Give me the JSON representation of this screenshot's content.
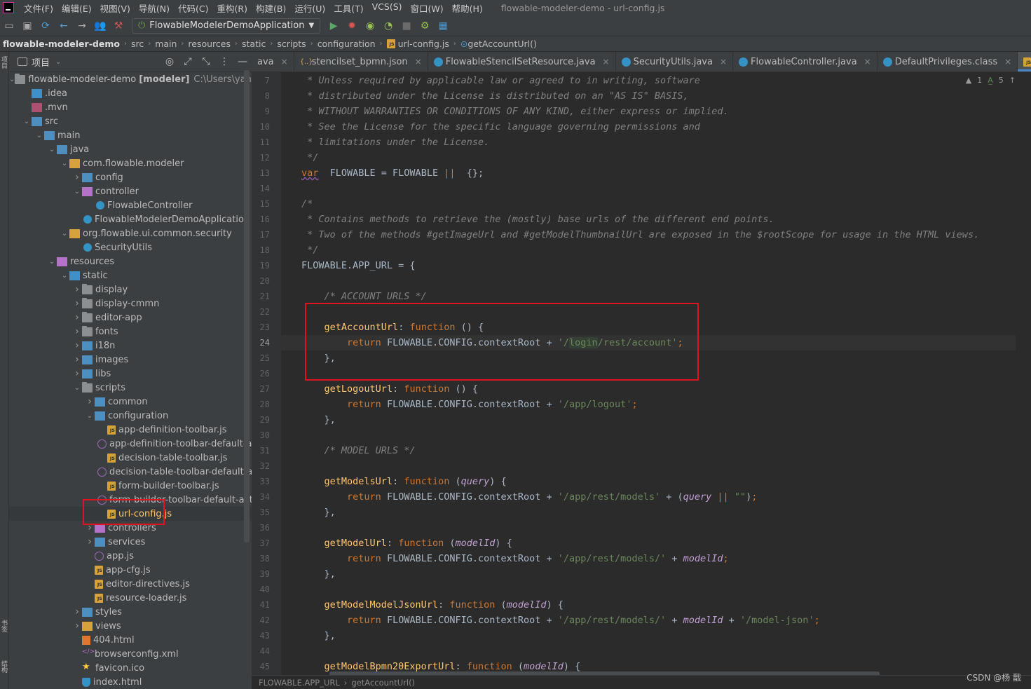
{
  "menu": {
    "items": [
      "文件(F)",
      "编辑(E)",
      "视图(V)",
      "导航(N)",
      "代码(C)",
      "重构(R)",
      "构建(B)",
      "运行(U)",
      "工具(T)",
      "VCS(S)",
      "窗口(W)",
      "帮助(H)"
    ],
    "window_title": "flowable-modeler-demo - url-config.js"
  },
  "toolbar": {
    "run_config": "FlowableModelerDemoApplication"
  },
  "breadcrumb": {
    "items": [
      "flowable-modeler-demo",
      "src",
      "main",
      "resources",
      "static",
      "scripts",
      "configuration",
      "url-config.js",
      "getAccountUrl()"
    ]
  },
  "project_panel": {
    "title": "项目"
  },
  "side_strip": {
    "top": "项目",
    "bottom1": "书签",
    "bottom2": "结构"
  },
  "tree": [
    {
      "label": "flowable-modeler-demo",
      "bold": "[modeler]",
      "path": "C:\\Users\\yangyongli\\",
      "icon": "folder",
      "depth": 0,
      "arrow": "down"
    },
    {
      "label": ".idea",
      "icon": "idea",
      "depth": 1,
      "arrow": "none"
    },
    {
      "label": ".mvn",
      "icon": "mvn",
      "depth": 1,
      "arrow": "none"
    },
    {
      "label": "src",
      "icon": "src",
      "depth": 1,
      "arrow": "down"
    },
    {
      "label": "main",
      "icon": "src",
      "depth": 2,
      "arrow": "down"
    },
    {
      "label": "java",
      "icon": "java",
      "depth": 3,
      "arrow": "down"
    },
    {
      "label": "com.flowable.modeler",
      "icon": "pkg",
      "depth": 4,
      "arrow": "down"
    },
    {
      "label": "config",
      "icon": "src",
      "depth": 5,
      "arrow": "right"
    },
    {
      "label": "controller",
      "icon": "res",
      "depth": 5,
      "arrow": "down"
    },
    {
      "label": "FlowableController",
      "icon": "cls",
      "depth": 6,
      "arrow": "none"
    },
    {
      "label": "FlowableModelerDemoApplication",
      "icon": "cls",
      "depth": 5,
      "arrow": "none"
    },
    {
      "label": "org.flowable.ui.common.security",
      "icon": "pkg",
      "depth": 4,
      "arrow": "down"
    },
    {
      "label": "SecurityUtils",
      "icon": "cls",
      "depth": 5,
      "arrow": "none"
    },
    {
      "label": "resources",
      "icon": "res",
      "depth": 3,
      "arrow": "down"
    },
    {
      "label": "static",
      "icon": "web",
      "depth": 4,
      "arrow": "down"
    },
    {
      "label": "display",
      "icon": "folder",
      "depth": 5,
      "arrow": "right"
    },
    {
      "label": "display-cmmn",
      "icon": "folder",
      "depth": 5,
      "arrow": "right"
    },
    {
      "label": "editor-app",
      "icon": "folder",
      "depth": 5,
      "arrow": "right"
    },
    {
      "label": "fonts",
      "icon": "folder",
      "depth": 5,
      "arrow": "right"
    },
    {
      "label": "i18n",
      "icon": "src",
      "depth": 5,
      "arrow": "right"
    },
    {
      "label": "images",
      "icon": "java",
      "depth": 5,
      "arrow": "right"
    },
    {
      "label": "libs",
      "icon": "java",
      "depth": 5,
      "arrow": "right"
    },
    {
      "label": "scripts",
      "icon": "folder",
      "depth": 5,
      "arrow": "down"
    },
    {
      "label": "common",
      "icon": "java",
      "depth": 6,
      "arrow": "right"
    },
    {
      "label": "configuration",
      "icon": "src",
      "depth": 6,
      "arrow": "down"
    },
    {
      "label": "app-definition-toolbar.js",
      "icon": "js",
      "depth": 7,
      "arrow": "none"
    },
    {
      "label": "app-definition-toolbar-default-actio",
      "icon": "jsalt",
      "depth": 7,
      "arrow": "none"
    },
    {
      "label": "decision-table-toolbar.js",
      "icon": "js",
      "depth": 7,
      "arrow": "none"
    },
    {
      "label": "decision-table-toolbar-default-actio",
      "icon": "jsalt",
      "depth": 7,
      "arrow": "none"
    },
    {
      "label": "form-builder-toolbar.js",
      "icon": "js",
      "depth": 7,
      "arrow": "none"
    },
    {
      "label": "form-builder-toolbar-default-action",
      "icon": "jsalt",
      "depth": 7,
      "arrow": "none"
    },
    {
      "label": "url-config.js",
      "icon": "js",
      "depth": 7,
      "arrow": "none",
      "selected": true
    },
    {
      "label": "controllers",
      "icon": "res",
      "depth": 6,
      "arrow": "right"
    },
    {
      "label": "services",
      "icon": "src",
      "depth": 6,
      "arrow": "right"
    },
    {
      "label": "app.js",
      "icon": "jsalt",
      "depth": 6,
      "arrow": "none"
    },
    {
      "label": "app-cfg.js",
      "icon": "js",
      "depth": 6,
      "arrow": "none"
    },
    {
      "label": "editor-directives.js",
      "icon": "js",
      "depth": 6,
      "arrow": "none"
    },
    {
      "label": "resource-loader.js",
      "icon": "js",
      "depth": 6,
      "arrow": "none"
    },
    {
      "label": "styles",
      "icon": "src",
      "depth": 5,
      "arrow": "right"
    },
    {
      "label": "views",
      "icon": "pkg",
      "depth": 5,
      "arrow": "right"
    },
    {
      "label": "404.html",
      "icon": "html",
      "depth": 5,
      "arrow": "none"
    },
    {
      "label": "browserconfig.xml",
      "icon": "xml",
      "depth": 5,
      "arrow": "none"
    },
    {
      "label": "favicon.ico",
      "icon": "star",
      "depth": 5,
      "arrow": "none"
    },
    {
      "label": "index.html",
      "icon": "shield",
      "depth": 5,
      "arrow": "none"
    }
  ],
  "tabs": [
    {
      "label": "ava",
      "icon": "none",
      "active": false
    },
    {
      "label": "stencilset_bpmn.json",
      "icon": "json",
      "active": false
    },
    {
      "label": "FlowableStencilSetResource.java",
      "icon": "class",
      "active": false
    },
    {
      "label": "SecurityUtils.java",
      "icon": "class",
      "active": false
    },
    {
      "label": "FlowableController.java",
      "icon": "class",
      "active": false
    },
    {
      "label": "DefaultPrivileges.class",
      "icon": "class",
      "active": false
    },
    {
      "label": "url-config.js",
      "icon": "js",
      "active": true
    }
  ],
  "inspections": {
    "warn": "1",
    "typo": "5"
  },
  "code": {
    "current_line": "24",
    "lines": [
      {
        "n": "7",
        "t": [
          [
            "cm",
            " * Unless required by applicable law or agreed to in writing, software"
          ]
        ]
      },
      {
        "n": "8",
        "t": [
          [
            "cm",
            " * distributed under the License is distributed on an \"AS IS\" BASIS,"
          ]
        ]
      },
      {
        "n": "9",
        "t": [
          [
            "cm",
            " * WITHOUT WARRANTIES OR CONDITIONS OF ANY KIND, either express or implied."
          ]
        ]
      },
      {
        "n": "10",
        "t": [
          [
            "cm",
            " * See the License for the specific language governing permissions and"
          ]
        ]
      },
      {
        "n": "11",
        "t": [
          [
            "cm",
            " * limitations under the License."
          ]
        ]
      },
      {
        "n": "12",
        "t": [
          [
            "cm",
            " */"
          ]
        ]
      },
      {
        "n": "13",
        "t": [
          [
            "kw wavy",
            "var"
          ],
          [
            "",
            "  FLOWABLE = FLOWABLE "
          ],
          [
            "kw",
            "||"
          ],
          [
            "",
            ""
          ],
          [
            "",
            "  {};"
          ]
        ]
      },
      {
        "n": "14",
        "t": []
      },
      {
        "n": "15",
        "t": [
          [
            "cm",
            "/*"
          ]
        ]
      },
      {
        "n": "16",
        "t": [
          [
            "cm",
            " * Contains methods to retrieve the (mostly) base urls of the different end points."
          ]
        ]
      },
      {
        "n": "17",
        "t": [
          [
            "cm",
            " * Two of the methods #getImageUrl and #getModelThumbnailUrl are exposed in the $rootScope for usage in the HTML views."
          ]
        ]
      },
      {
        "n": "18",
        "t": [
          [
            "cm",
            " */"
          ]
        ]
      },
      {
        "n": "19",
        "t": [
          [
            "",
            "FLOWABLE.APP_URL = {"
          ]
        ]
      },
      {
        "n": "20",
        "t": []
      },
      {
        "n": "21",
        "t": [
          [
            "cm",
            "    /* ACCOUNT URLS */"
          ]
        ]
      },
      {
        "n": "22",
        "t": []
      },
      {
        "n": "23",
        "t": [
          [
            "",
            "    "
          ],
          [
            "fn",
            "getAccountUrl"
          ],
          [
            "",
            ": "
          ],
          [
            "kw",
            "function"
          ],
          [
            "",
            " () {"
          ]
        ]
      },
      {
        "n": "24",
        "t": [
          [
            "",
            "        "
          ],
          [
            "kw",
            "return"
          ],
          [
            "",
            " FLOWABLE.CONFIG.contextRoot + "
          ],
          [
            "str",
            "'/"
          ],
          [
            "hl",
            "login"
          ],
          [
            "str",
            "/rest/account'"
          ],
          [
            "kw",
            ";"
          ]
        ]
      },
      {
        "n": "25",
        "t": [
          [
            "",
            "    },"
          ]
        ]
      },
      {
        "n": "26",
        "t": []
      },
      {
        "n": "27",
        "t": [
          [
            "",
            "    "
          ],
          [
            "fn",
            "getLogoutUrl"
          ],
          [
            "",
            ": "
          ],
          [
            "kw",
            "function"
          ],
          [
            "",
            " () {"
          ]
        ]
      },
      {
        "n": "28",
        "t": [
          [
            "",
            "        "
          ],
          [
            "kw",
            "return"
          ],
          [
            "",
            " FLOWABLE.CONFIG.contextRoot + "
          ],
          [
            "str",
            "'/app/logout'"
          ],
          [
            "kw",
            ";"
          ]
        ]
      },
      {
        "n": "29",
        "t": [
          [
            "",
            "    },"
          ]
        ]
      },
      {
        "n": "30",
        "t": []
      },
      {
        "n": "31",
        "t": [
          [
            "cm",
            "    /* MODEL URLS */"
          ]
        ]
      },
      {
        "n": "32",
        "t": []
      },
      {
        "n": "33",
        "t": [
          [
            "",
            "    "
          ],
          [
            "fn",
            "getModelsUrl"
          ],
          [
            "",
            ": "
          ],
          [
            "kw",
            "function"
          ],
          [
            "",
            " ("
          ],
          [
            "prm",
            "query"
          ],
          [
            "",
            ") {"
          ]
        ]
      },
      {
        "n": "34",
        "t": [
          [
            "",
            "        "
          ],
          [
            "kw",
            "return"
          ],
          [
            "",
            " FLOWABLE.CONFIG.contextRoot + "
          ],
          [
            "str",
            "'/app/rest/models'"
          ],
          [
            "",
            " + ("
          ],
          [
            "prm",
            "query"
          ],
          [
            "",
            " "
          ],
          [
            "kw",
            "||"
          ],
          [
            "",
            " "
          ],
          [
            "str",
            "\"\""
          ],
          [
            "",
            ")"
          ],
          [
            "kw",
            ";"
          ]
        ]
      },
      {
        "n": "35",
        "t": [
          [
            "",
            "    },"
          ]
        ]
      },
      {
        "n": "36",
        "t": []
      },
      {
        "n": "37",
        "t": [
          [
            "",
            "    "
          ],
          [
            "fn",
            "getModelUrl"
          ],
          [
            "",
            ": "
          ],
          [
            "kw",
            "function"
          ],
          [
            "",
            " ("
          ],
          [
            "prm",
            "modelId"
          ],
          [
            "",
            ") {"
          ]
        ]
      },
      {
        "n": "38",
        "t": [
          [
            "",
            "        "
          ],
          [
            "kw",
            "return"
          ],
          [
            "",
            " FLOWABLE.CONFIG.contextRoot + "
          ],
          [
            "str",
            "'/app/rest/models/'"
          ],
          [
            "",
            " + "
          ],
          [
            "prm",
            "modelId"
          ],
          [
            "kw",
            ";"
          ]
        ]
      },
      {
        "n": "39",
        "t": [
          [
            "",
            "    },"
          ]
        ]
      },
      {
        "n": "40",
        "t": []
      },
      {
        "n": "41",
        "t": [
          [
            "",
            "    "
          ],
          [
            "fn",
            "getModelModelJsonUrl"
          ],
          [
            "",
            ": "
          ],
          [
            "kw",
            "function"
          ],
          [
            "",
            " ("
          ],
          [
            "prm",
            "modelId"
          ],
          [
            "",
            ") {"
          ]
        ]
      },
      {
        "n": "42",
        "t": [
          [
            "",
            "        "
          ],
          [
            "kw",
            "return"
          ],
          [
            "",
            " FLOWABLE.CONFIG.contextRoot + "
          ],
          [
            "str",
            "'/app/rest/models/'"
          ],
          [
            "",
            " + "
          ],
          [
            "prm",
            "modelId"
          ],
          [
            "",
            " + "
          ],
          [
            "str",
            "'/model-json'"
          ],
          [
            "kw",
            ";"
          ]
        ]
      },
      {
        "n": "43",
        "t": [
          [
            "",
            "    },"
          ]
        ]
      },
      {
        "n": "44",
        "t": []
      },
      {
        "n": "45",
        "t": [
          [
            "",
            "    "
          ],
          [
            "fn",
            "getModelBpmn20ExportUrl"
          ],
          [
            "",
            ": "
          ],
          [
            "kw",
            "function"
          ],
          [
            "",
            " ("
          ],
          [
            "prm",
            "modelId"
          ],
          [
            "",
            ") {"
          ]
        ]
      }
    ]
  },
  "status": {
    "crumb1": "FLOWABLE.APP_URL",
    "crumb2": "getAccountUrl()"
  },
  "watermark": "CSDN @杨 戬",
  "colors": {
    "highlight_box": "#e0141e",
    "accent": "#4a88c7"
  }
}
